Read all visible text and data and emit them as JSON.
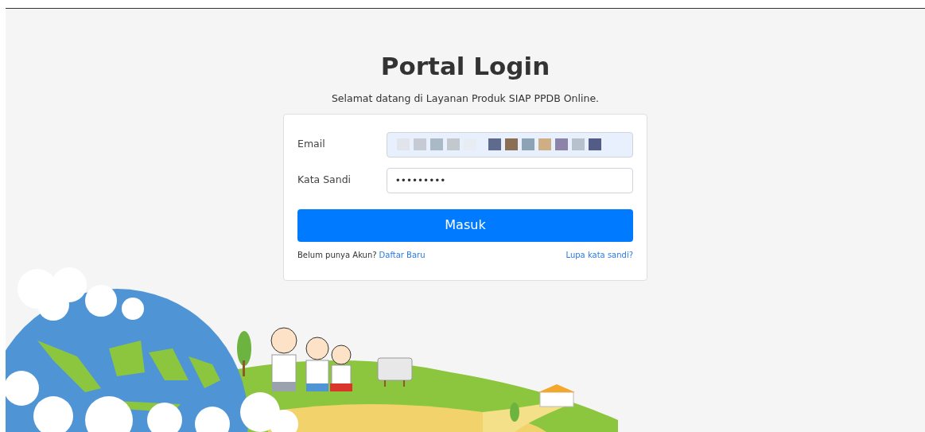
{
  "title": "Portal Login",
  "subtitle": "Selamat datang di Layanan Produk SIAP PPDB Online.",
  "form": {
    "fields": [
      {
        "label": "Email",
        "kind": "text",
        "redacted": true,
        "autofilled": true
      },
      {
        "label": "Kata Sandi",
        "kind": "password",
        "value": "•••••••••",
        "autofilled": false
      }
    ],
    "submit": "Masuk",
    "register_prompt": "Belum punya Akun?",
    "register_link": "Daftar Baru",
    "forgot_link": "Lupa kata sandi?"
  }
}
